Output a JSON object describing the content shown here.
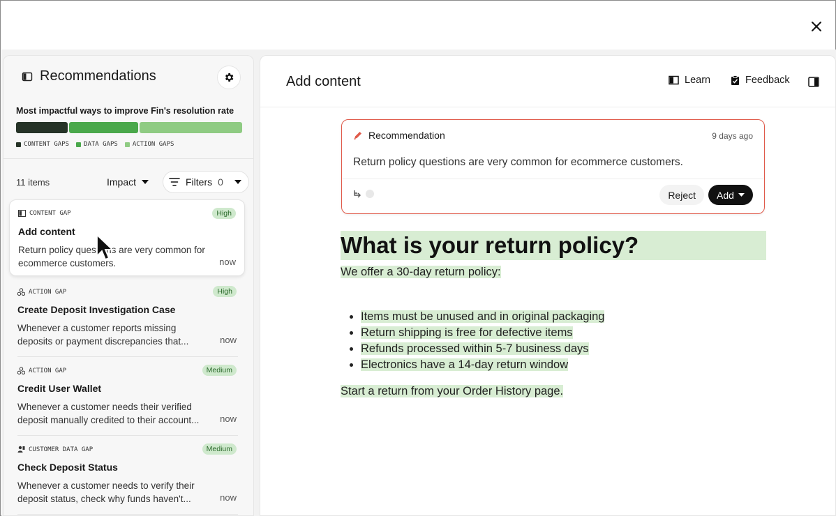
{
  "left": {
    "title": "Recommendations",
    "impact_title": "Most impactful ways to improve Fin's resolution rate",
    "bar_segments": [
      {
        "name": "content",
        "fraction": 0.23,
        "color": "#263327"
      },
      {
        "name": "data",
        "fraction": 0.31,
        "color": "#4aa84b"
      },
      {
        "name": "action",
        "fraction": 0.46,
        "color": "#8fcb83"
      }
    ],
    "legend": [
      "CONTENT GAPS",
      "DATA GAPS",
      "ACTION GAPS"
    ],
    "items_count": "11 items",
    "sort_label": "Impact",
    "filters_label": "Filters",
    "filters_count": "0",
    "cards": [
      {
        "type": "CONTENT GAP",
        "badge": "High",
        "title": "Add content",
        "desc_line1": "Return policy questions are very common for",
        "desc_line2": "ecommerce customers.",
        "time": "now"
      },
      {
        "type": "ACTION GAP",
        "badge": "High",
        "title": "Create Deposit Investigation Case",
        "desc_line1": "Whenever a customer reports missing",
        "desc_line2": "deposits or payment discrepancies that...",
        "time": "now"
      },
      {
        "type": "ACTION GAP",
        "badge": "Medium",
        "title": "Credit User Wallet",
        "desc_line1": "Whenever a customer needs their verified",
        "desc_line2": "deposit manually credited to their account...",
        "time": "now"
      },
      {
        "type": "CUSTOMER DATA GAP",
        "badge": "Medium",
        "title": "Check Deposit Status",
        "desc_line1": "Whenever a customer needs to verify their",
        "desc_line2": "deposit status, check why funds haven't...",
        "time": "now"
      }
    ]
  },
  "right": {
    "title": "Add content",
    "learn_label": "Learn",
    "feedback_label": "Feedback",
    "rec": {
      "label": "Recommendation",
      "time": "9 days ago",
      "text": "Return policy questions are very common for ecommerce customers.",
      "reject_label": "Reject",
      "add_label": "Add"
    },
    "doc": {
      "heading": "What is your return policy?",
      "intro": "We offer a 30-day return policy:",
      "bullets": [
        "Items must be unused and in original packaging",
        "Return shipping is free for defective items",
        "Refunds processed within 5-7 business days",
        "Electronics have a 14-day return window"
      ],
      "outro": "Start a return from your Order History page."
    }
  }
}
